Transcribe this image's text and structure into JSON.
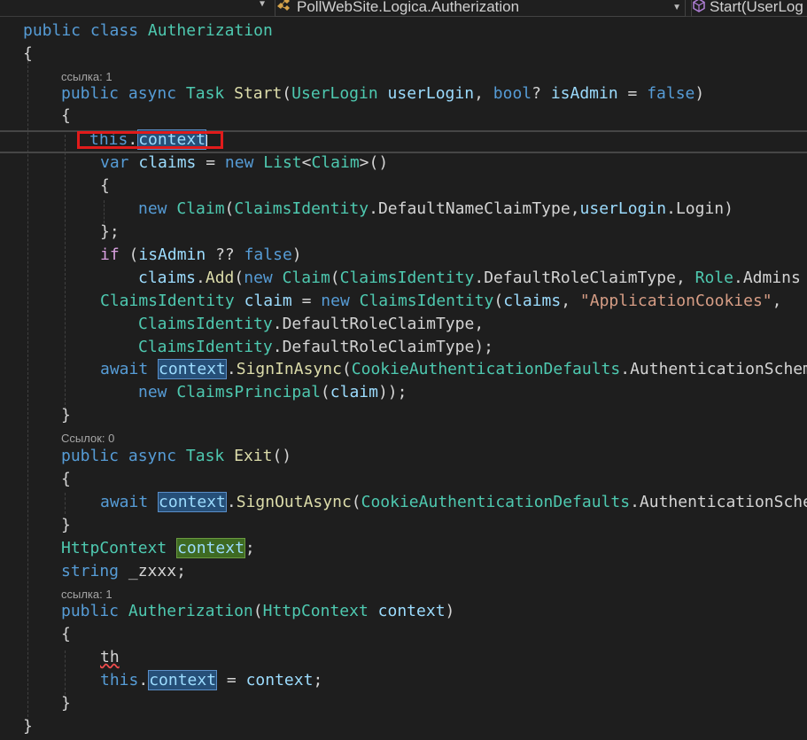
{
  "navbar": {
    "member_dropdown": "PollWebSite.Logica.Autherization",
    "method_dropdown": "Start(UserLog"
  },
  "lens": {
    "l1": "ссылка: 1",
    "l2": "Ссылок: 0",
    "l3": "ссылка: 1"
  },
  "code": {
    "public": "public",
    "class": "class",
    "async": "async",
    "class_name": "Autherization",
    "brace_open": "{",
    "brace_close": "}",
    "task": "Task",
    "start": "Start",
    "userlogin_type": "UserLogin",
    "userlogin_param": "userLogin",
    "bool_q": "bool",
    "isadmin": "isAdmin",
    "false": "false",
    "this": "this",
    "context": "context",
    "var": "var",
    "claims": "claims",
    "new": "new",
    "list": "List",
    "claim_type": "Claim",
    "claims_identity": "ClaimsIdentity",
    "default_name": "DefaultNameClaimType",
    "login": "Login",
    "if": "if",
    "add": "Add",
    "default_role": "DefaultRoleClaimType",
    "role": "Role",
    "admins": "Admins",
    "claim_var": "claim",
    "app_cookies": "\"ApplicationCookies\"",
    "await": "await",
    "signin": "SignInAsync",
    "cookie_defaults": "CookieAuthenticationDefaults",
    "auth_scheme_signin": "AuthenticationSchem",
    "claims_principal": "ClaimsPrincipal",
    "exit": "Exit",
    "signout": "SignOutAsync",
    "auth_scheme_signout": "AuthenticationSche",
    "httpcontext": "HttpContext",
    "string": "string",
    "zxxx": "_zxxx",
    "th": "th"
  },
  "colors": {
    "background": "#1e1e1e",
    "keyword": "#569cd6",
    "type": "#4ec9b0",
    "method": "#dcdcaa",
    "variable": "#9cdcfe",
    "string": "#d69d85",
    "highlight_box": "#e11b1b"
  }
}
